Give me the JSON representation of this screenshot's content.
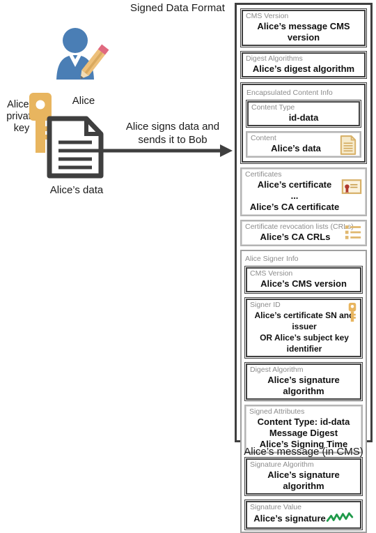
{
  "diagram": {
    "title": "Signed Data Format",
    "actor_label": "Alice",
    "private_key_label": "Alice’s\nprivate\nkey",
    "private_key_lines": [
      "Alice’s",
      "private",
      "key"
    ],
    "document_label": "Alice’s  data",
    "arrow_lines": [
      "Alice signs data and",
      "sends it to Bob"
    ],
    "cms_caption": "Alice’s message (in CMS)"
  },
  "colors": {
    "person_blue": "#4a7eb5",
    "key_gold": "#e8b55f",
    "pencil_tan": "#edc07a",
    "eraser_pink": "#e0697f",
    "doc_outline": "#3f3f3f",
    "icon_gold": "#e0b870",
    "seal_red": "#b03a2e",
    "signature_green": "#1f9a4a",
    "box_dark": "#3f3f3f",
    "box_light": "#a8a8a8",
    "label_gray": "#8c8c8c"
  },
  "cms": {
    "fields": [
      {
        "id": "cms-version",
        "label": "CMS Version",
        "value": "Alice’s message CMS version",
        "style": "dark",
        "icon": null
      },
      {
        "id": "digest-algorithms",
        "label": "Digest Algorithms",
        "value": "Alice’s digest algorithm",
        "style": "dark",
        "icon": null
      },
      {
        "id": "encapsulated-content-info",
        "label": "Encapsulated Content Info",
        "value": null,
        "style": "group",
        "children": [
          {
            "id": "content-type",
            "label": "Content Type",
            "value": "id-data",
            "style": "dark",
            "icon": null
          },
          {
            "id": "content",
            "label": "Content",
            "value": "Alice’s data",
            "style": "lite",
            "icon": "document-icon"
          }
        ]
      },
      {
        "id": "certificates",
        "label": "Certificates",
        "value": "Alice’s certificate\n...\nAlice’s CA certificate",
        "style": "lite",
        "icon": "certificate-icon",
        "value_lines": [
          "Alice’s certificate",
          "...",
          "Alice’s CA certificate"
        ]
      },
      {
        "id": "crls",
        "label": "Certificate revocation lists (CRLs)",
        "value": "Alice’s CA CRLs",
        "style": "lite",
        "icon": "list-icon"
      },
      {
        "id": "alice-signer-info",
        "label": "Alice Signer Info",
        "value": null,
        "style": "group-lite",
        "children": [
          {
            "id": "signer-cms-version",
            "label": "CMS Version",
            "value": "Alice’s CMS version",
            "style": "dark",
            "icon": null
          },
          {
            "id": "signer-id",
            "label": "Signer ID",
            "value": "Alice’s certificate SN and issuer\nOR Alice’s subject key identifier",
            "style": "dark",
            "icon": "key-icon",
            "value_lines": [
              "Alice’s certificate SN and issuer",
              "OR Alice’s subject key identifier"
            ]
          },
          {
            "id": "signer-digest-algorithm",
            "label": "Digest Algorithm",
            "value": "Alice’s signature algorithm",
            "style": "dark",
            "icon": null
          },
          {
            "id": "signed-attributes",
            "label": "Signed Attributes",
            "value": "Content Type: id-data\nMessage Digest\nAlice’s Signing Time",
            "style": "lite",
            "icon": null,
            "value_lines": [
              "Content Type: id-data",
              "Message Digest",
              "Alice’s Signing Time"
            ]
          },
          {
            "id": "signature-algorithm",
            "label": "Signature Algorithm",
            "value": "Alice’s signature algorithm",
            "style": "dark",
            "icon": null
          },
          {
            "id": "signature-value",
            "label": "Signature Value",
            "value": "Alice’s signature",
            "style": "dark",
            "icon": "signature-squiggle-icon"
          }
        ]
      }
    ]
  }
}
